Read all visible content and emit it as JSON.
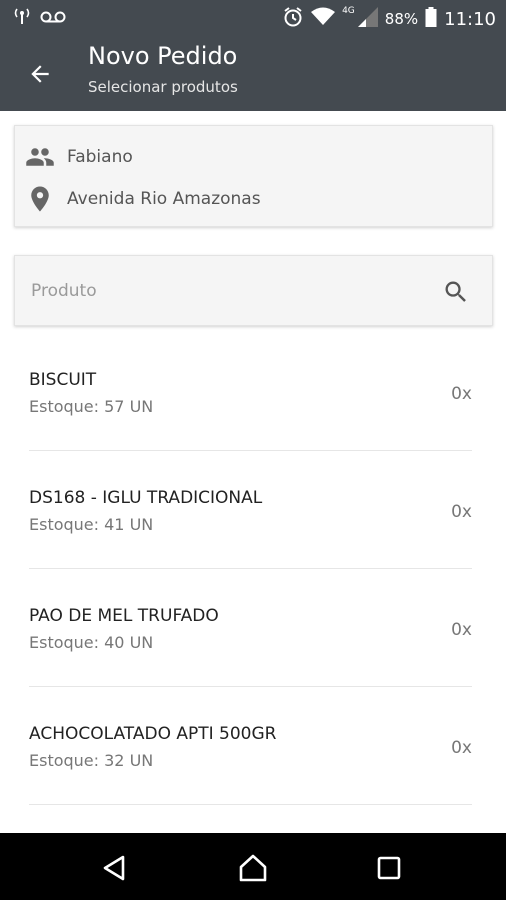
{
  "status_bar": {
    "battery": "88%",
    "time": "11:10",
    "network": "4G",
    "icons": [
      "antenna-icon",
      "voicemail-icon",
      "alarm-icon",
      "wifi-icon",
      "signal-icon",
      "battery-icon"
    ]
  },
  "header": {
    "title": "Novo Pedido",
    "subtitle": "Selecionar produtos",
    "background": "#444a50"
  },
  "customer": {
    "name": "Fabiano",
    "address": "Avenida Rio Amazonas"
  },
  "search": {
    "placeholder": "Produto",
    "value": ""
  },
  "products": [
    {
      "name": "BISCUIT",
      "stock": "Estoque: 57 UN",
      "qty": "0x"
    },
    {
      "name": "DS168 - IGLU TRADICIONAL",
      "stock": "Estoque: 41 UN",
      "qty": "0x"
    },
    {
      "name": "PAO DE MEL TRUFADO",
      "stock": "Estoque: 40 UN",
      "qty": "0x"
    },
    {
      "name": "ACHOCOLATADO APTI 500GR",
      "stock": "Estoque: 32 UN",
      "qty": "0x"
    }
  ]
}
